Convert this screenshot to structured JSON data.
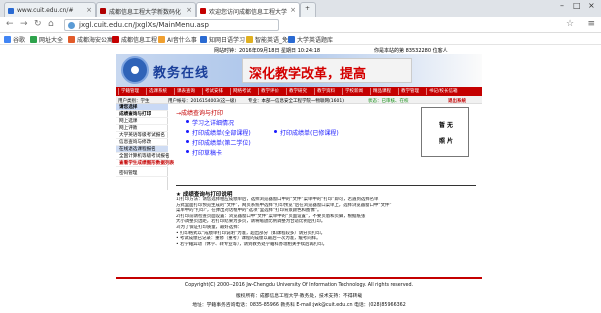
{
  "browser": {
    "tabs": [
      {
        "title": "www.cuit.edu.cn/#",
        "active": false,
        "color": "#2a6ad2"
      },
      {
        "title": "成都信息工程大学新数码化",
        "active": false,
        "color": "#b00000"
      },
      {
        "title": "欢迎您访问成都信息工程大学",
        "active": true,
        "color": "#c40000"
      }
    ],
    "url": "jxgl.cuit.edu.cn/JxglXs/MainMenu.asp",
    "bookmarks": [
      {
        "label": "谷歌",
        "color": "#4285f4"
      },
      {
        "label": "网址大全",
        "color": "#2ea34c"
      },
      {
        "label": "成都海安公寓",
        "color": "#e25b2a"
      },
      {
        "label": "成都信息工程",
        "color": "#c40000"
      },
      {
        "label": "AI音什么事",
        "color": "#f0a030"
      },
      {
        "label": "知网日语学习",
        "color": "#2a6ad2"
      },
      {
        "label": "智能英语_免",
        "color": "#e0b020"
      },
      {
        "label": "大学英语题库",
        "color": "#2a6ad2"
      }
    ]
  },
  "site": {
    "top_time": "网站时钟：2016年09月18日 星期日 10:24:18",
    "top_user": "你是本站的第 83532280 位客人",
    "logo_text": "教务在线",
    "slogan": "深化教学改革，提高",
    "nav": [
      "学籍管理",
      "选课系统",
      "课表查询",
      "考试安排",
      "网络考试",
      "教学评价",
      "教学研究",
      "教学资料",
      "学校新闻",
      "精品课程",
      "教学管理",
      "书记/校长信箱"
    ],
    "userline": {
      "name": "用户类别：学生",
      "id": "用户帐号：2016154003(这一级)",
      "major": "专业：本部一信息安全工程学院一物联网(1601)",
      "status": "状态：已审核、在校",
      "logout": "退出系统"
    }
  },
  "sidebar": [
    {
      "label": "请您选择",
      "style": "head"
    },
    {
      "label": "成绩查询与打印",
      "style": "bold"
    },
    {
      "label": "网上选课",
      "style": "normal"
    },
    {
      "label": "网上评教",
      "style": "normal"
    },
    {
      "label": "大学英语等级考试报名",
      "style": "normal"
    },
    {
      "label": "信息查询与修改",
      "style": "normal"
    },
    {
      "label": "在线退选课程报名",
      "style": "highlight"
    },
    {
      "label": "全国计算机等级考试报名",
      "style": "normal"
    },
    {
      "label": "查看学生成绩图形数据列表",
      "style": "red"
    },
    {
      "label": "密码管理",
      "style": "normal"
    }
  ],
  "main": {
    "crumb": "→成绩查询与打印",
    "links": [
      "学习之详细情况",
      "打印成绩单(全部课程)",
      "打印成绩单(已修课程)",
      "打印成绩单(第二学位)",
      "打印草稿卡"
    ],
    "photo_line1": "暂  无",
    "photo_line2": "照  片"
  },
  "notice": {
    "title": "★ 成绩查询与打印说明",
    "lines": [
      "1)打印方法：请您选择相应成绩单后，选择浏览器窗口中的“文件”菜单中的“打印”即可，若遇到选择名单",
      "方式里面打印预览生成的“文件”，网页系统中选择“打印预览”后在浏览器窗口菜单上，选择浏览器窗口中“文件”",
      "菜单中的“打印”，在弹出对话框中的“选项”里选择“打印背景颜色和图像”。",
      "2)打印前请检查页面设置：浏览器窗口中“文件”菜单中的“页面设置”，不要页眉和页脚，根据纸张",
      "大小调整页边距，若打印结果为多页，请将缩放比例调整为合适比例后打印。",
      "3)为了保证打印质量，最好选择：",
      "• 打印格式以“成绩单打印说明”为准，超出部分（如课程较多）请分页打印。",
      "• 考试成绩已记录：重修（重考）课程的成绩以最后一次为准，缓考同样。",
      "• 若学籍异动（休学、转专业等），请到教务处学籍科办理相关手续后再打印。"
    ]
  },
  "footer": {
    "line1": "Copyright(C) 2000--2016 Jw-Chengdu University Of Information Technology.  All rights reserved.",
    "line2": "版权所有：成都信息工程大学·教务处，技术支持：不得转载",
    "line3": "地址：学籍事务咨询电话：0835-85966   教务科 E-mail:jwk@cuit.edu.cn    电话：(028)85966362"
  }
}
